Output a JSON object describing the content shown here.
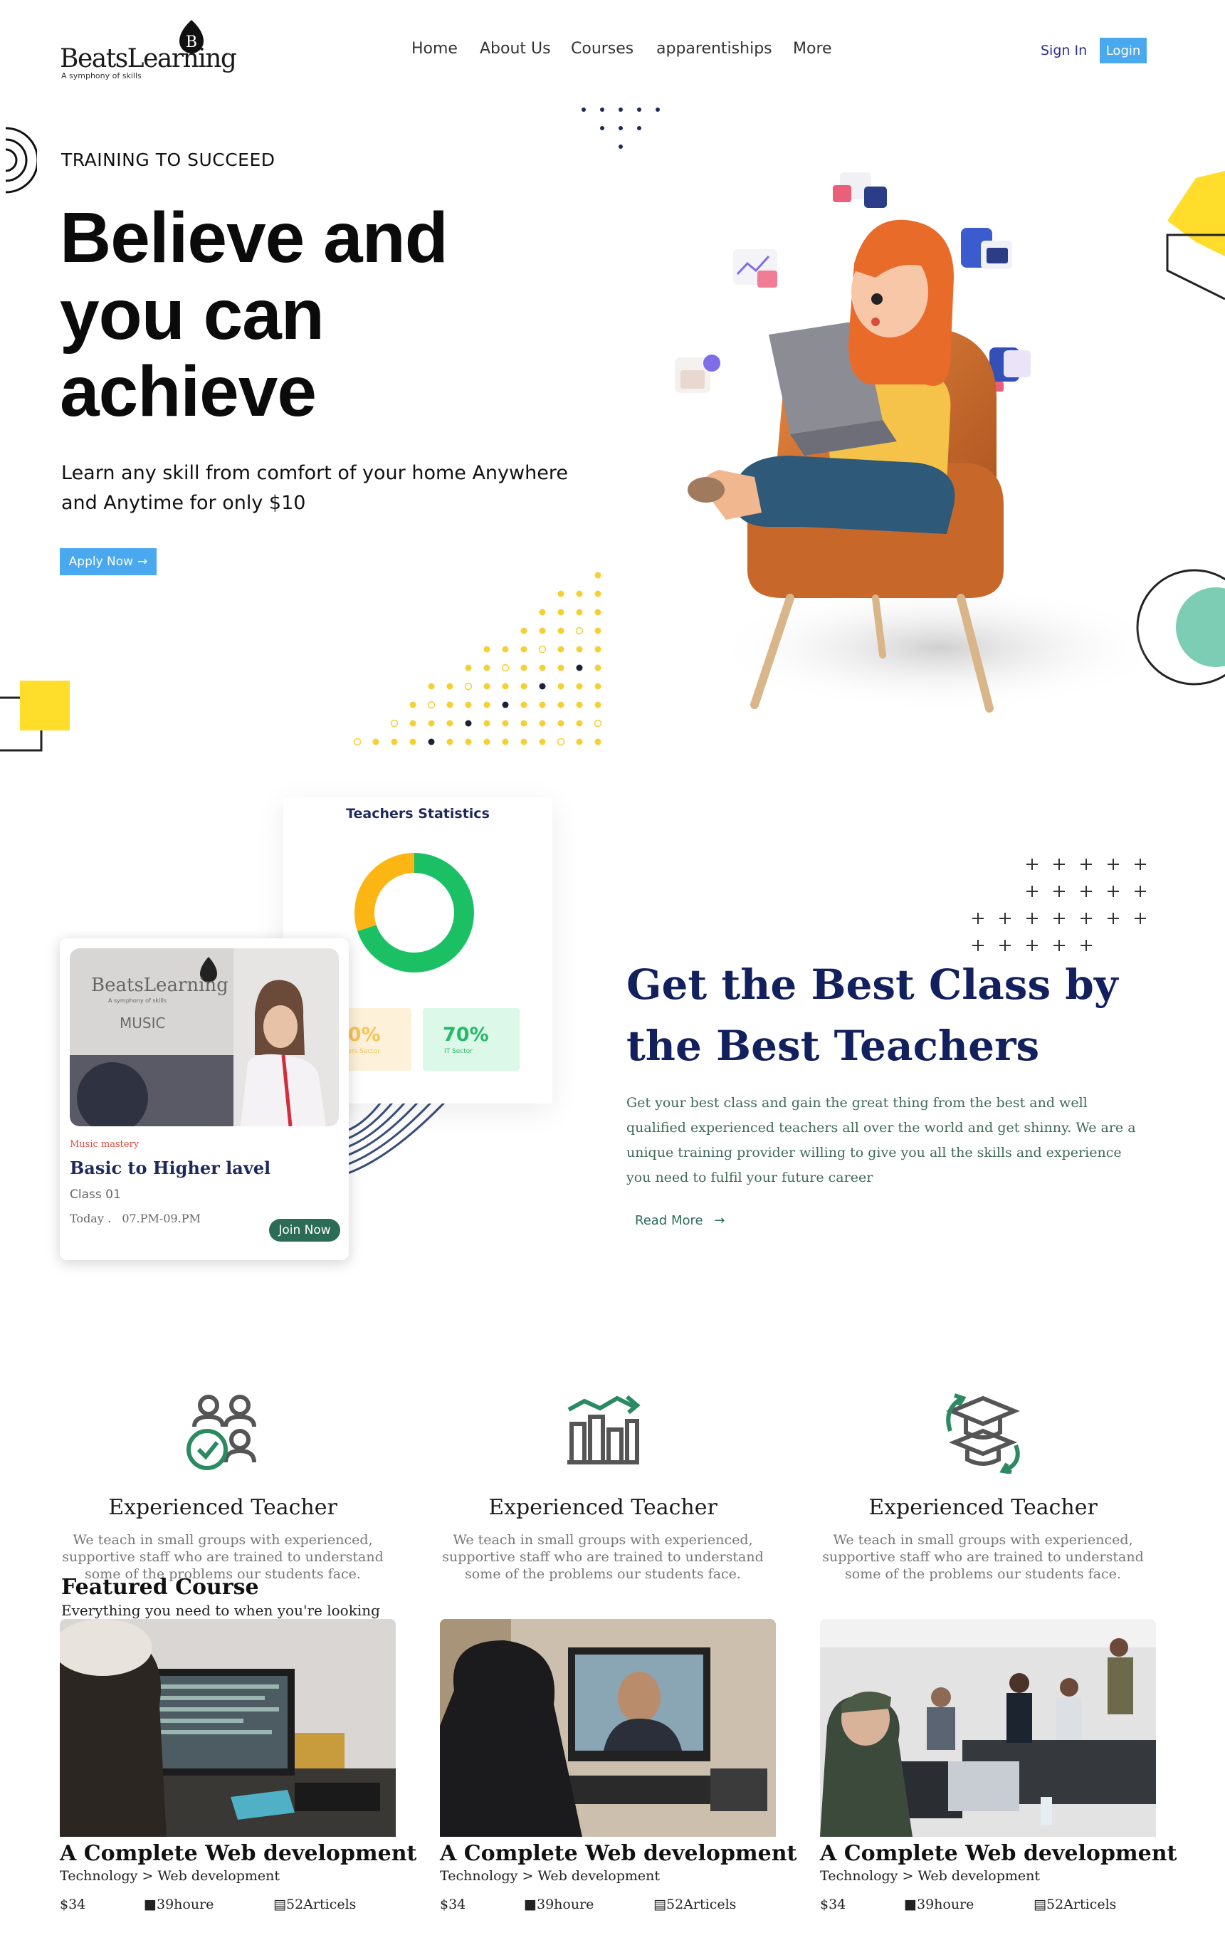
{
  "brand": {
    "name": "BeatsLearning",
    "tagline": "A symphony of skills",
    "mark": "B"
  },
  "nav": {
    "items": [
      "Home",
      "About Us",
      "Courses",
      "apparentiships",
      "More"
    ],
    "signin": "Sign In",
    "login": "Login"
  },
  "hero": {
    "eyebrow": "TRAINING TO SUCCEED",
    "title": "Believe and you can achieve",
    "subtitle": "Learn any skill from comfort of your home Anywhere and Anytime for only $10",
    "cta": "Apply Now"
  },
  "stats": {
    "title": "Teachers Statistics",
    "chart_data": {
      "type": "pie",
      "title": "Teachers Statistics",
      "categories": [
        "Others Sector",
        "IT Sector"
      ],
      "values": [
        30,
        70
      ],
      "colors": [
        "#fbb614",
        "#1cc064"
      ]
    },
    "pills": [
      {
        "value": "30%",
        "label": "Others Sector",
        "color": "#f7c35a",
        "bg": "#fef1d9"
      },
      {
        "value": "70%",
        "label": "IT Sector",
        "color": "#27b86a",
        "bg": "#dcf8e8"
      }
    ]
  },
  "mini_course": {
    "photo_brand": "BeatsLearning",
    "photo_tagline": "A symphony of skills",
    "photo_word": "MUSIC",
    "category": "Music mastery",
    "title": "Basic to Higher lavel",
    "class": "Class 01",
    "time": "Today .   07.PM-09.PM",
    "cta": "Join Now"
  },
  "best": {
    "title": "Get the Best Class by the Best Teachers",
    "text": "Get your best class and gain the great thing from the best and well qualified experienced teachers all over the world and get shinny. We are a unique training provider willing to give you all the skills and experience you need to fulfil your future career",
    "read_more": "Read More"
  },
  "features": [
    {
      "icon": "teachers-icon",
      "title": "Experienced Teacher",
      "text": "We teach in small groups with experienced, supportive staff who are trained to understand some of the problems our students face."
    },
    {
      "icon": "growth-chart-icon",
      "title": "Experienced Teacher",
      "text": "We teach in small groups with experienced, supportive staff who are trained to understand some of the problems our students face."
    },
    {
      "icon": "graduation-cap-icon",
      "title": "Experienced Teacher",
      "text": "We teach in small groups with experienced, supportive staff who are trained to understand some of the problems our students face."
    }
  ],
  "featured": {
    "heading": "Featured Course",
    "subheading": "Everything you need to when you're looking",
    "courses": [
      {
        "title": "A Complete Web development",
        "category": "Technology > Web development",
        "price": "$34",
        "hours": "39houre",
        "articles": "52Articels"
      },
      {
        "title": "A Complete Web development",
        "category": "Technology > Web development",
        "price": "$34",
        "hours": "39houre",
        "articles": "52Articels"
      },
      {
        "title": "A Complete Web development",
        "category": "Technology > Web development",
        "price": "$34",
        "hours": "39houre",
        "articles": "52Articels"
      }
    ]
  },
  "colors": {
    "accent": "#4aa8ef",
    "navy": "#13205e",
    "green": "#2c6c56",
    "yellow": "#ffdd2a"
  }
}
